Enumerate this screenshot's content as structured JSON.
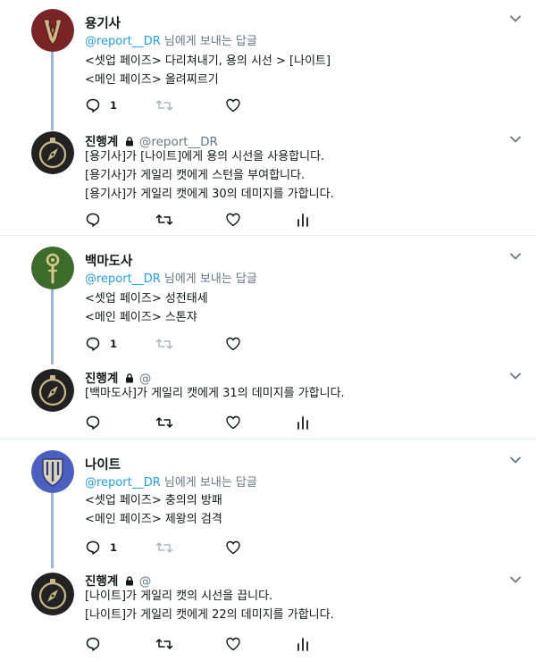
{
  "threads": [
    {
      "top": {
        "name": "용기사",
        "reply_prefix": "@report__DR",
        "reply_suffix": " 님에게 보내는 답글",
        "lines": [
          "<셋업 페이즈> 다리쳐내기, 용의 시선 > [나이트]",
          "<메인 페이즈> 올려찌르기"
        ],
        "reply_count": "1",
        "avatar": "dragoon-icon"
      },
      "reply": {
        "name": "진행계",
        "handle": "@report__DR",
        "lines": [
          "[용기사]가 [나이트]에게 용의 시선을 사용합니다.",
          "[용기사]가 게일리 캣에게 스턴을 부여합니다.",
          "[용기사]가 게일리 캣에게 30의 데미지를 가합니다."
        ],
        "avatar": "compass-icon"
      }
    },
    {
      "top": {
        "name": "백마도사",
        "reply_prefix": "@report__DR",
        "reply_suffix": " 님에게 보내는 답글",
        "lines": [
          "<셋업 페이즈> 성전태세",
          "<메인 페이즈> 스톤쟈"
        ],
        "reply_count": "1",
        "avatar": "white-mage-icon"
      },
      "reply": {
        "name": "진행계",
        "handle": "@",
        "lines": [
          "[백마도사]가 게일리 캣에게 31의 데미지를 가합니다."
        ],
        "avatar": "compass-icon"
      }
    },
    {
      "top": {
        "name": "나이트",
        "reply_prefix": "@report__DR",
        "reply_suffix": " 님에게 보내는 답글",
        "lines": [
          "<셋업 페이즈> 충의의 방패",
          "<메인 페이즈> 제왕의 검격"
        ],
        "reply_count": "1",
        "avatar": "paladin-icon"
      },
      "reply": {
        "name": "진행계",
        "handle": "@",
        "lines": [
          "[나이트]가 게일리 캣의 시선을 끕니다.",
          "[나이트]가 게일리 캣에게 22의 데미지를 가합니다."
        ],
        "avatar": "compass-icon"
      }
    }
  ],
  "colors": {
    "accent": "#1da1f2",
    "thread_line": "#9ab4dd",
    "secondary_text": "#657786",
    "dragoon_bg": "#7a2428",
    "white_mage_bg": "#3d6b2a",
    "paladin_bg": "#4a5fbf",
    "compass_bg": "#222222"
  }
}
